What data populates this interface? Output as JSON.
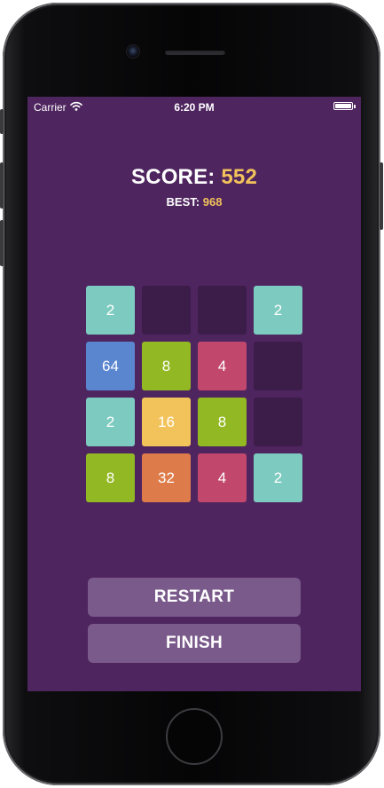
{
  "status_bar": {
    "carrier": "Carrier",
    "time": "6:20 PM",
    "wifi_icon": "wifi-icon",
    "battery_icon": "battery-icon"
  },
  "score": {
    "label": "SCORE:",
    "value": "552"
  },
  "best": {
    "label": "BEST:",
    "value": "968"
  },
  "board": {
    "rows": [
      [
        "2",
        "",
        "",
        "2"
      ],
      [
        "64",
        "8",
        "4",
        ""
      ],
      [
        "2",
        "16",
        "8",
        ""
      ],
      [
        "8",
        "32",
        "4",
        "2"
      ]
    ]
  },
  "buttons": {
    "restart": "RESTART",
    "finish": "FINISH"
  },
  "colors": {
    "background": "#4e255f",
    "empty_cell": "#3c1d4a",
    "accent_score": "#f2c35b",
    "button": "#7a5a8b",
    "tiles": {
      "2": "#7dcbc0",
      "4": "#c2476d",
      "8": "#92b823",
      "16": "#f2c35b",
      "32": "#dd7c4a",
      "64": "#5a85cf"
    }
  }
}
